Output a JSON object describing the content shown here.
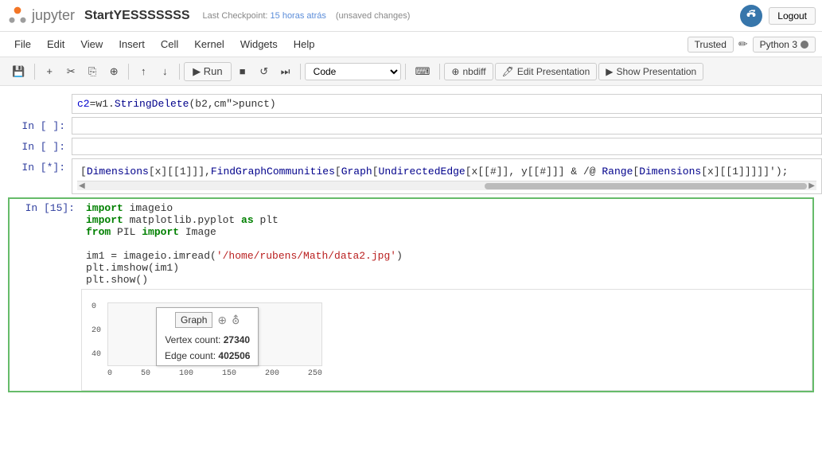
{
  "topbar": {
    "logo_text": "jupyter",
    "title": "StartYESSSSSSS",
    "checkpoint_label": "Last Checkpoint:",
    "checkpoint_time": "15 horas atrás",
    "unsaved": "(unsaved changes)",
    "python_logo_alt": "python-logo",
    "logout_label": "Logout"
  },
  "menubar": {
    "items": [
      "File",
      "Edit",
      "View",
      "Insert",
      "Cell",
      "Kernel",
      "Widgets",
      "Help"
    ],
    "trusted": "Trusted",
    "pencil": "✏",
    "kernel_name": "Python 3"
  },
  "toolbar": {
    "save_icon": "💾",
    "add_icon": "+",
    "cut_icon": "✂",
    "copy_icon": "⎘",
    "paste_icon": "⊕",
    "move_up_icon": "↑",
    "move_down_icon": "↓",
    "run_label": "▶ Run",
    "stop_icon": "■",
    "restart_icon": "↺",
    "fast_forward_icon": "⏭",
    "cell_type": "Code",
    "keyboard_icon": "⌨",
    "nbdiff_label": "nbdiff",
    "edit_presentation_label": "Edit Presentation",
    "show_presentation_label": "Show Presentation"
  },
  "cells": [
    {
      "prompt": "",
      "type": "code",
      "content": "c2=w1.StringDelete(b2,punct)"
    },
    {
      "prompt": "In [ ]:",
      "type": "code",
      "content": ""
    },
    {
      "prompt": "In [ ]:",
      "type": "code",
      "content": ""
    },
    {
      "prompt": "In [*]:",
      "type": "code",
      "content": "[Dimensions[x][[1]]],FindGraphCommunities[Graph[UndirectedEdge[x[[#]], y[[#]]] & /@ Range[Dimensions[x][[1]]]]]');"
    }
  ],
  "active_cell": {
    "prompt": "In [15]:",
    "lines": [
      "import imageio",
      "import matplotlib.pyplot as plt",
      "from PIL import Image",
      "",
      "im1 = imageio.imread('/home/rubens/Math/data2.jpg')",
      "plt.imshow(im1)",
      "plt.show()"
    ]
  },
  "graph_output": {
    "y_labels": [
      "0",
      "20",
      "40"
    ],
    "x_labels": [
      "0",
      "50",
      "100",
      "150",
      "200",
      "250"
    ],
    "graph_label": "Graph",
    "vertex_count_label": "Vertex count:",
    "vertex_count": "27340",
    "edge_count_label": "Edge count:",
    "edge_count": "402506"
  }
}
